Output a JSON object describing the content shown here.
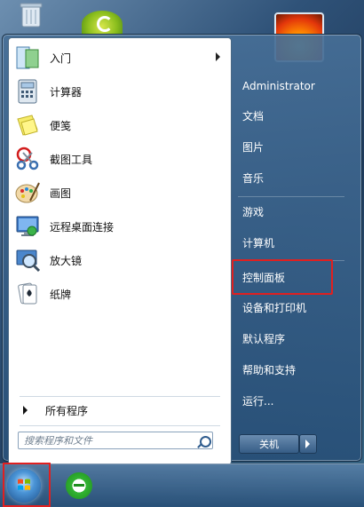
{
  "programs": [
    {
      "label": "入门",
      "icon": "getting-started-icon",
      "has_submenu": true
    },
    {
      "label": "计算器",
      "icon": "calculator-icon",
      "has_submenu": false
    },
    {
      "label": "便笺",
      "icon": "sticky-notes-icon",
      "has_submenu": false
    },
    {
      "label": "截图工具",
      "icon": "snipping-tool-icon",
      "has_submenu": false
    },
    {
      "label": "画图",
      "icon": "paint-icon",
      "has_submenu": false
    },
    {
      "label": "远程桌面连接",
      "icon": "remote-desktop-icon",
      "has_submenu": false
    },
    {
      "label": "放大镜",
      "icon": "magnifier-icon",
      "has_submenu": false
    },
    {
      "label": "纸牌",
      "icon": "solitaire-icon",
      "has_submenu": false
    }
  ],
  "all_programs_label": "所有程序",
  "search": {
    "placeholder": "搜索程序和文件"
  },
  "right_items": [
    {
      "label": "Administrator"
    },
    {
      "label": "文档"
    },
    {
      "label": "图片"
    },
    {
      "label": "音乐"
    },
    {
      "label": "游戏"
    },
    {
      "label": "计算机"
    },
    {
      "label": "控制面板",
      "highlighted": true
    },
    {
      "label": "设备和打印机"
    },
    {
      "label": "默认程序"
    },
    {
      "label": "帮助和支持"
    },
    {
      "label": "运行..."
    }
  ],
  "shutdown_label": "关机",
  "colors": {
    "highlight": "#e02020",
    "menu_bg": "#2f5278"
  }
}
